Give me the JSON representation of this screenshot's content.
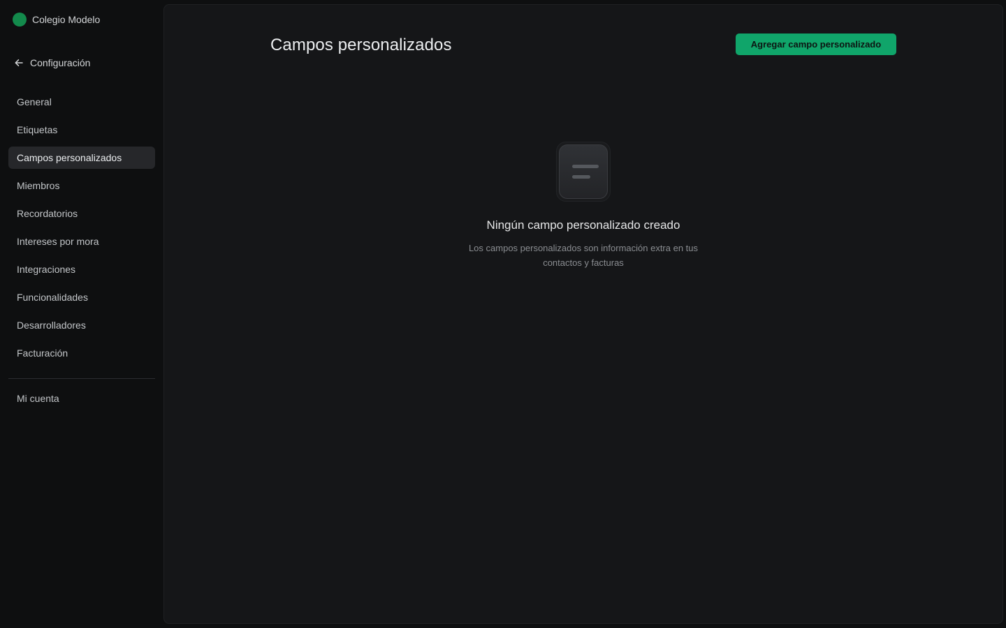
{
  "org": {
    "name": "Colegio Modelo",
    "avatar_color": "#138a4c"
  },
  "back": {
    "label": "Configuración",
    "icon": "arrow-left-icon"
  },
  "sidebar": {
    "items": [
      {
        "label": "General",
        "active": false
      },
      {
        "label": "Etiquetas",
        "active": false
      },
      {
        "label": "Campos personalizados",
        "active": true
      },
      {
        "label": "Miembros",
        "active": false
      },
      {
        "label": "Recordatorios",
        "active": false
      },
      {
        "label": "Intereses por mora",
        "active": false
      },
      {
        "label": "Integraciones",
        "active": false
      },
      {
        "label": "Funcionalidades",
        "active": false
      },
      {
        "label": "Desarrolladores",
        "active": false
      },
      {
        "label": "Facturación",
        "active": false
      }
    ],
    "account_label": "Mi cuenta"
  },
  "main": {
    "title": "Campos personalizados",
    "add_button_label": "Agregar campo personalizado",
    "empty_state": {
      "icon": "document-lines-icon",
      "title": "Ningún campo personalizado creado",
      "description": "Los campos personalizados son información extra en tus contactos y facturas"
    }
  },
  "colors": {
    "accent": "#10a56a",
    "background": "#0e0f10",
    "panel": "#151618"
  }
}
